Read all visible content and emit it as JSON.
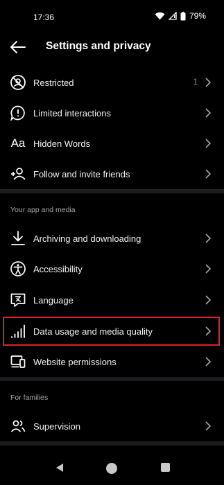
{
  "status_bar": {
    "time": "17:36",
    "battery": "79%"
  },
  "header": {
    "title": "Settings and privacy"
  },
  "items_top": [
    {
      "label": "Restricted",
      "count": "1",
      "icon": "restricted-icon"
    },
    {
      "label": "Limited interactions",
      "icon": "limited-interactions-icon"
    },
    {
      "label": "Hidden Words",
      "icon": "hidden-words-icon",
      "glyph": "Aa"
    },
    {
      "label": "Follow and invite friends",
      "icon": "add-person-icon"
    }
  ],
  "section_app": {
    "title": "Your app and media",
    "items": [
      {
        "label": "Archiving and downloading",
        "icon": "download-icon"
      },
      {
        "label": "Accessibility",
        "icon": "accessibility-icon"
      },
      {
        "label": "Language",
        "icon": "language-icon"
      },
      {
        "label": "Data usage and media quality",
        "icon": "signal-bars-icon"
      },
      {
        "label": "Website permissions",
        "icon": "devices-icon"
      }
    ]
  },
  "section_families": {
    "title": "For families",
    "items": [
      {
        "label": "Supervision",
        "icon": "supervision-icon"
      }
    ]
  },
  "colors": {
    "background": "#000000",
    "separator": "#1c1c1e",
    "highlight": "#e3202a"
  }
}
